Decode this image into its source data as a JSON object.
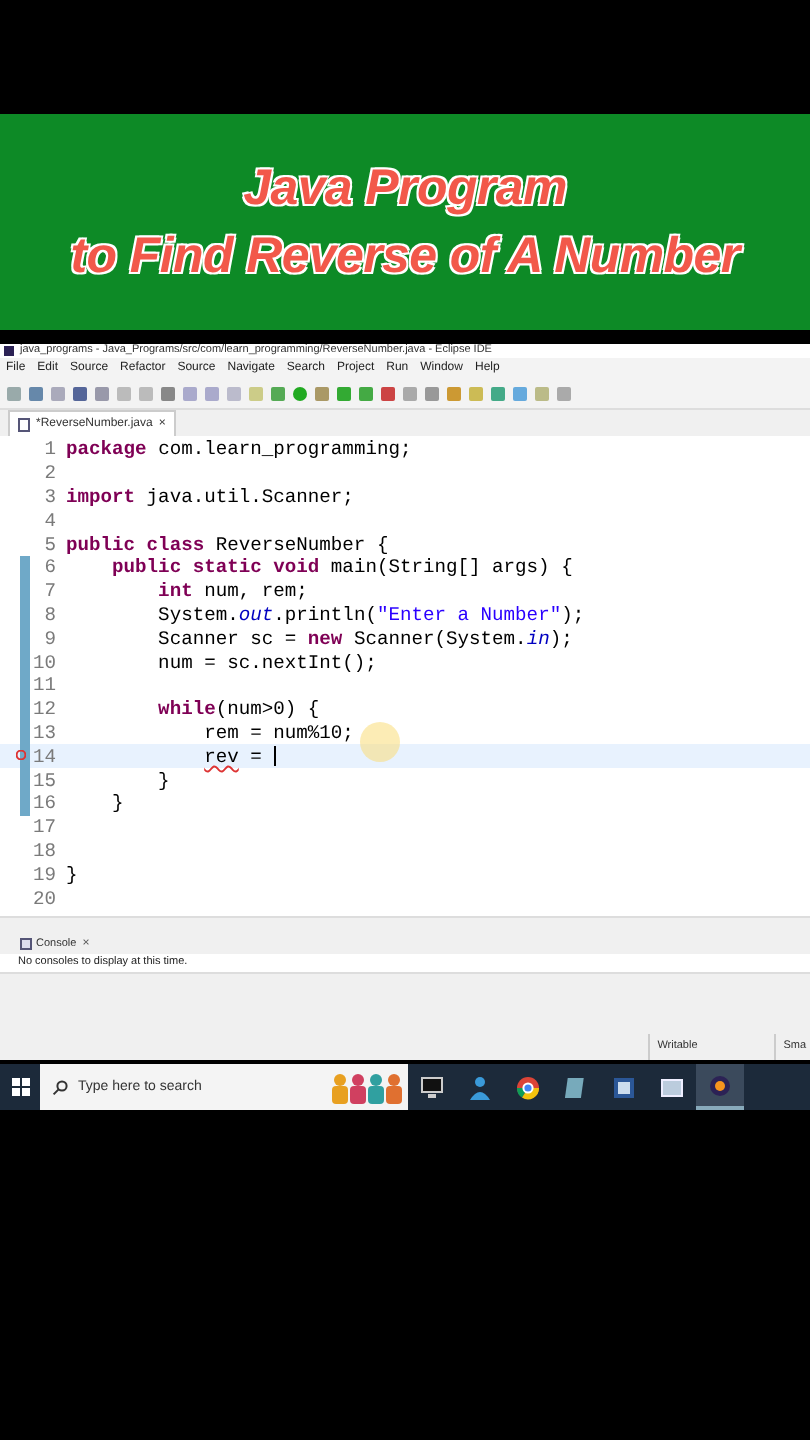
{
  "video_title": {
    "lines": [
      "Java Program",
      "to Find Reverse of A Number"
    ]
  },
  "window": {
    "title": "java_programs - Java_Programs/src/com/learn_programming/ReverseNumber.java - Eclipse IDE",
    "menu": [
      "File",
      "Edit",
      "Source",
      "Refactor",
      "Source",
      "Navigate",
      "Search",
      "Project",
      "Run",
      "Window",
      "Help"
    ]
  },
  "editor": {
    "tab": {
      "label": "*ReverseNumber.java",
      "close": "×"
    },
    "lines": [
      {
        "number": "1",
        "changed": false,
        "current": false,
        "error": false,
        "tokens": [
          {
            "text": "package",
            "kind": "keyword"
          },
          {
            "text": " com.learn_programming;",
            "kind": "plain"
          }
        ]
      },
      {
        "number": "2",
        "changed": false,
        "current": false,
        "error": false
      },
      {
        "number": "3",
        "changed": false,
        "current": false,
        "error": false,
        "tokens": [
          {
            "text": "import",
            "kind": "keyword"
          },
          {
            "text": " java.util.Scanner;",
            "kind": "plain"
          }
        ]
      },
      {
        "number": "4",
        "changed": false,
        "current": false,
        "error": false
      },
      {
        "number": "5",
        "changed": false,
        "current": false,
        "error": false,
        "tokens": [
          {
            "text": "public class",
            "kind": "keyword"
          },
          {
            "text": " ReverseNumber {",
            "kind": "plain"
          }
        ]
      },
      {
        "number": "6",
        "changed": true,
        "current": false,
        "error": false,
        "tokens": [
          {
            "text": "    public static void",
            "kind": "keyword"
          },
          {
            "text": " main(String[] args) {",
            "kind": "plain"
          }
        ]
      },
      {
        "number": "7",
        "changed": true,
        "current": false,
        "error": false,
        "tokens": [
          {
            "text": "        int",
            "kind": "keyword"
          },
          {
            "text": " num, rem;",
            "kind": "plain"
          }
        ]
      },
      {
        "number": "8",
        "changed": true,
        "current": false,
        "error": false,
        "tokens": [
          {
            "text": "        System.",
            "kind": "plain"
          },
          {
            "text": "out",
            "kind": "field"
          },
          {
            "text": ".println(",
            "kind": "plain"
          },
          {
            "text": "\"Enter a Number\"",
            "kind": "string"
          },
          {
            "text": ");",
            "kind": "plain"
          }
        ]
      },
      {
        "number": "9",
        "changed": true,
        "current": false,
        "error": false,
        "tokens": [
          {
            "text": "        Scanner sc = ",
            "kind": "plain"
          },
          {
            "text": "new",
            "kind": "keyword"
          },
          {
            "text": " Scanner(System.",
            "kind": "plain"
          },
          {
            "text": "in",
            "kind": "field"
          },
          {
            "text": ");",
            "kind": "plain"
          }
        ]
      },
      {
        "number": "10",
        "changed": true,
        "current": false,
        "error": false,
        "tokens": [
          {
            "text": "        num = sc.nextInt();",
            "kind": "plain"
          }
        ]
      },
      {
        "number": "11",
        "changed": true,
        "current": false,
        "error": false
      },
      {
        "number": "12",
        "changed": true,
        "current": false,
        "error": false,
        "tokens": [
          {
            "text": "        while",
            "kind": "keyword"
          },
          {
            "text": "(num>0) {",
            "kind": "plain"
          }
        ]
      },
      {
        "number": "13",
        "changed": true,
        "current": false,
        "error": false,
        "tokens": [
          {
            "text": "            rem = num%10;",
            "kind": "plain"
          }
        ]
      },
      {
        "number": "14",
        "changed": true,
        "current": true,
        "error": true,
        "tokens": [
          {
            "text": "            rev",
            "kind": "error"
          },
          {
            "text": " =",
            "kind": "plain"
          }
        ]
      },
      {
        "number": "15",
        "changed": true,
        "current": false,
        "error": false,
        "tokens": [
          {
            "text": "        }",
            "kind": "plain"
          }
        ]
      },
      {
        "number": "16",
        "changed": true,
        "current": false,
        "error": false,
        "tokens": [
          {
            "text": "    }",
            "kind": "plain"
          }
        ]
      },
      {
        "number": "17",
        "changed": false,
        "current": false,
        "error": false
      },
      {
        "number": "18",
        "changed": false,
        "current": false,
        "error": false
      },
      {
        "number": "19",
        "changed": false,
        "current": false,
        "error": false,
        "tokens": [
          {
            "text": "}",
            "kind": "plain"
          }
        ]
      },
      {
        "number": "20",
        "changed": false,
        "current": false,
        "error": false
      }
    ]
  },
  "console": {
    "tab": "Console",
    "close": "×",
    "message": "No consoles to display at this time."
  },
  "status_bar": {
    "fields": [
      "Writable",
      "Sma"
    ]
  },
  "taskbar": {
    "search": {
      "placeholder": "Type here to search"
    },
    "apps": [
      {
        "kind": "monitor",
        "selected": false
      },
      {
        "kind": "person",
        "selected": false
      },
      {
        "kind": "browser",
        "selected": false
      },
      {
        "kind": "notes",
        "selected": false
      },
      {
        "kind": "document",
        "selected": false
      },
      {
        "kind": "window",
        "selected": false
      },
      {
        "kind": "eclipse",
        "selected": true
      }
    ]
  }
}
